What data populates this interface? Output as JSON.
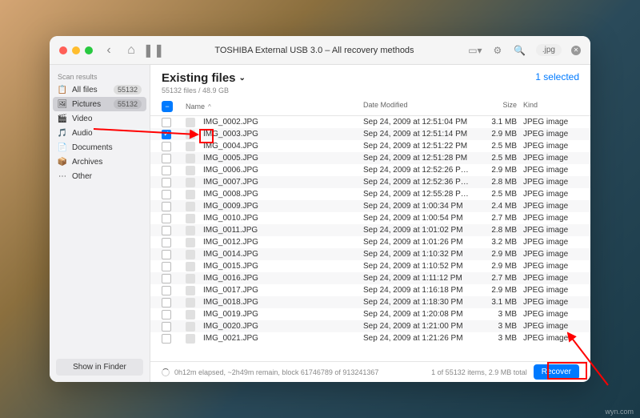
{
  "titlebar": {
    "title": "TOSHIBA External USB 3.0 – All recovery methods",
    "search_value": ".jpg"
  },
  "sidebar": {
    "header": "Scan results",
    "items": [
      {
        "icon": "📋",
        "label": "All files",
        "count": "55132"
      },
      {
        "icon": "🖼",
        "label": "Pictures",
        "count": "55132"
      },
      {
        "icon": "🎬",
        "label": "Video",
        "count": ""
      },
      {
        "icon": "🎵",
        "label": "Audio",
        "count": ""
      },
      {
        "icon": "📄",
        "label": "Documents",
        "count": ""
      },
      {
        "icon": "📦",
        "label": "Archives",
        "count": ""
      },
      {
        "icon": "⋯",
        "label": "Other",
        "count": ""
      }
    ],
    "finder_btn": "Show in Finder"
  },
  "main": {
    "title": "Existing files",
    "subtitle": "55132 files / 48.9 GB",
    "selected": "1 selected"
  },
  "columns": {
    "name": "Name",
    "date": "Date Modified",
    "size": "Size",
    "kind": "Kind"
  },
  "files": [
    {
      "checked": false,
      "name": "IMG_0002.JPG",
      "date": "Sep 24, 2009 at 12:51:04 PM",
      "size": "3.1 MB",
      "kind": "JPEG image"
    },
    {
      "checked": true,
      "name": "IMG_0003.JPG",
      "date": "Sep 24, 2009 at 12:51:14 PM",
      "size": "2.9 MB",
      "kind": "JPEG image"
    },
    {
      "checked": false,
      "name": "IMG_0004.JPG",
      "date": "Sep 24, 2009 at 12:51:22 PM",
      "size": "2.5 MB",
      "kind": "JPEG image"
    },
    {
      "checked": false,
      "name": "IMG_0005.JPG",
      "date": "Sep 24, 2009 at 12:51:28 PM",
      "size": "2.5 MB",
      "kind": "JPEG image"
    },
    {
      "checked": false,
      "name": "IMG_0006.JPG",
      "date": "Sep 24, 2009 at 12:52:26 P…",
      "size": "2.9 MB",
      "kind": "JPEG image"
    },
    {
      "checked": false,
      "name": "IMG_0007.JPG",
      "date": "Sep 24, 2009 at 12:52:36 P…",
      "size": "2.8 MB",
      "kind": "JPEG image"
    },
    {
      "checked": false,
      "name": "IMG_0008.JPG",
      "date": "Sep 24, 2009 at 12:55:28 P…",
      "size": "2.5 MB",
      "kind": "JPEG image"
    },
    {
      "checked": false,
      "name": "IMG_0009.JPG",
      "date": "Sep 24, 2009 at 1:00:34 PM",
      "size": "2.4 MB",
      "kind": "JPEG image"
    },
    {
      "checked": false,
      "name": "IMG_0010.JPG",
      "date": "Sep 24, 2009 at 1:00:54 PM",
      "size": "2.7 MB",
      "kind": "JPEG image"
    },
    {
      "checked": false,
      "name": "IMG_0011.JPG",
      "date": "Sep 24, 2009 at 1:01:02 PM",
      "size": "2.8 MB",
      "kind": "JPEG image"
    },
    {
      "checked": false,
      "name": "IMG_0012.JPG",
      "date": "Sep 24, 2009 at 1:01:26 PM",
      "size": "3.2 MB",
      "kind": "JPEG image"
    },
    {
      "checked": false,
      "name": "IMG_0014.JPG",
      "date": "Sep 24, 2009 at 1:10:32 PM",
      "size": "2.9 MB",
      "kind": "JPEG image"
    },
    {
      "checked": false,
      "name": "IMG_0015.JPG",
      "date": "Sep 24, 2009 at 1:10:52 PM",
      "size": "2.9 MB",
      "kind": "JPEG image"
    },
    {
      "checked": false,
      "name": "IMG_0016.JPG",
      "date": "Sep 24, 2009 at 1:11:12 PM",
      "size": "2.7 MB",
      "kind": "JPEG image"
    },
    {
      "checked": false,
      "name": "IMG_0017.JPG",
      "date": "Sep 24, 2009 at 1:16:18 PM",
      "size": "2.9 MB",
      "kind": "JPEG image"
    },
    {
      "checked": false,
      "name": "IMG_0018.JPG",
      "date": "Sep 24, 2009 at 1:18:30 PM",
      "size": "3.1 MB",
      "kind": "JPEG image"
    },
    {
      "checked": false,
      "name": "IMG_0019.JPG",
      "date": "Sep 24, 2009 at 1:20:08 PM",
      "size": "3 MB",
      "kind": "JPEG image"
    },
    {
      "checked": false,
      "name": "IMG_0020.JPG",
      "date": "Sep 24, 2009 at 1:21:00 PM",
      "size": "3 MB",
      "kind": "JPEG image"
    },
    {
      "checked": false,
      "name": "IMG_0021.JPG",
      "date": "Sep 24, 2009 at 1:21:26 PM",
      "size": "3 MB",
      "kind": "JPEG image"
    }
  ],
  "status": {
    "left": "0h12m elapsed, ~2h49m remain, block 61746789 of 913241367",
    "right": "1 of 55132 items, 2.9 MB total",
    "recover": "Recover"
  },
  "watermark": "wyn.com"
}
